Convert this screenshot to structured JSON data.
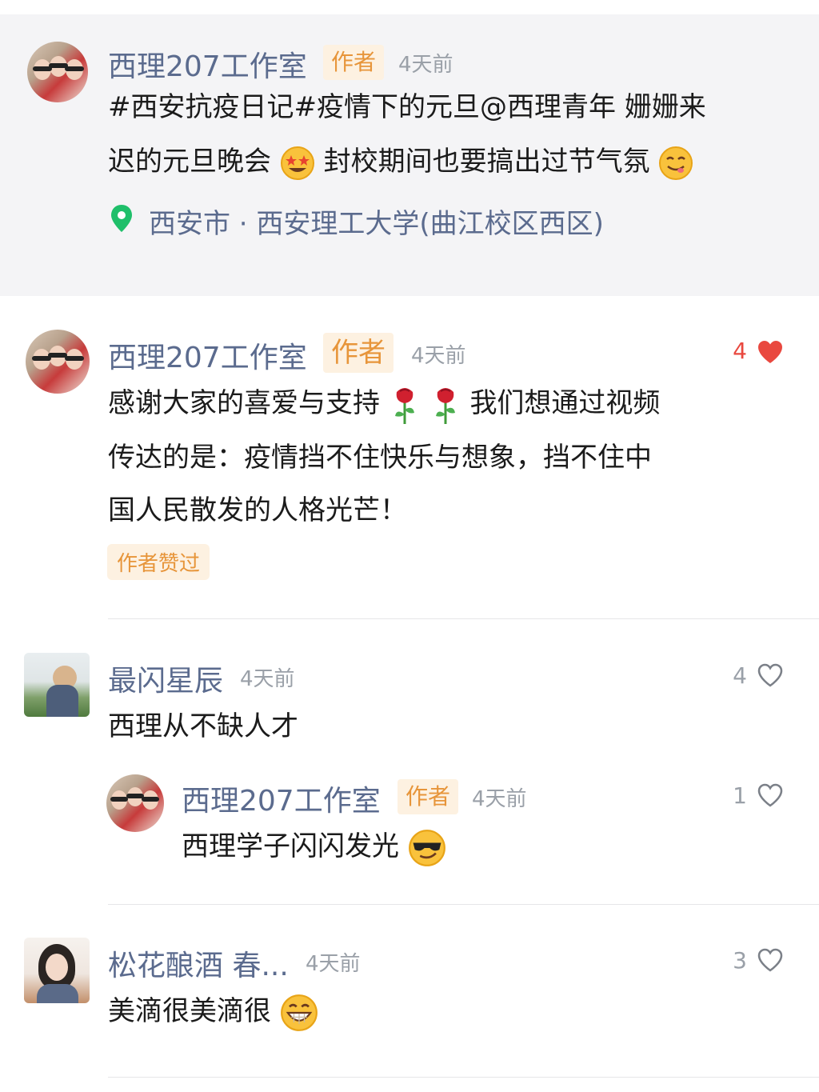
{
  "post": {
    "author": "西理207工作室",
    "author_badge": "作者",
    "time": "4天前",
    "text_line1": "#西安抗疫日记#疫情下的元旦@西理青年 姗姗来",
    "text_line2a": "迟的元旦晚会",
    "text_line2b": " 封校期间也要搞出过节气氛",
    "location": "西安市 · 西安理工大学(曲江校区西区)"
  },
  "comments": [
    {
      "author": "西理207工作室",
      "badge": "作者",
      "time": "4天前",
      "likes": "4",
      "liked": true,
      "lines": [
        "感谢大家的喜爱与支持",
        "我们想通过视频",
        "传达的是：疫情挡不住快乐与想象，挡不住中",
        "国人民散发的人格光芒！"
      ],
      "author_liked_badge": "作者赞过"
    },
    {
      "author": "最闪星辰",
      "time": "4天前",
      "likes": "4",
      "text": "西理从不缺人才",
      "reply": {
        "author": "西理207工作室",
        "badge": "作者",
        "time": "4天前",
        "likes": "1",
        "text": "西理学子闪闪发光"
      }
    },
    {
      "author": "松花酿酒 春...",
      "time": "4天前",
      "likes": "3",
      "text": "美滴很美滴很"
    }
  ],
  "icons": {
    "location": "location-pin-icon",
    "heart_filled": "heart-filled-icon",
    "heart_outline": "heart-outline-icon"
  },
  "colors": {
    "name": "#5b6b8e",
    "badge": "#e7953a",
    "like_red": "#e9483f",
    "location_green": "#1fbf6a"
  }
}
